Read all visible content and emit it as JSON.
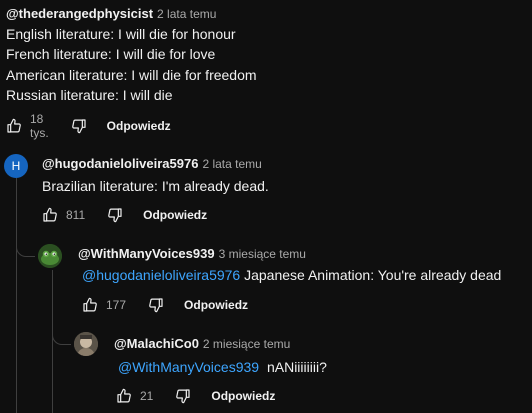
{
  "comments": [
    {
      "handle": "@thederangedphysicist",
      "time": "2 lata temu",
      "lines": [
        "English literature: I will die for honour",
        "French literature: I will die for love",
        "American literature: I will die for freedom",
        "Russian literature: I will die"
      ],
      "likes": "18 tys.",
      "reply_label": "Odpowiedz"
    },
    {
      "handle": "@hugodanieloliveira5976",
      "time": "2 lata temu",
      "avatar_letter": "H",
      "avatar_color": "#1565c0",
      "lines": [
        "Brazilian literature: I'm already dead."
      ],
      "likes": "811",
      "reply_label": "Odpowiedz"
    },
    {
      "handle": "@WithManyVoices939",
      "time": "3 miesiące temu",
      "mention": "@hugodanieloliveira5976",
      "text": "Japanese Animation: You're already dead",
      "likes": "177",
      "reply_label": "Odpowiedz"
    },
    {
      "handle": "@MalachiCo0",
      "time": "2 miesiące temu",
      "mention": "@WithManyVoices939",
      "text": "nANiiiiiiii?",
      "likes": "21",
      "reply_label": "Odpowiedz"
    }
  ],
  "colors": {
    "background": "#0f0f0f",
    "text": "#f1f1f1",
    "secondary": "#aaaaaa",
    "link": "#3ea6ff",
    "thread": "#3f3f3f"
  }
}
